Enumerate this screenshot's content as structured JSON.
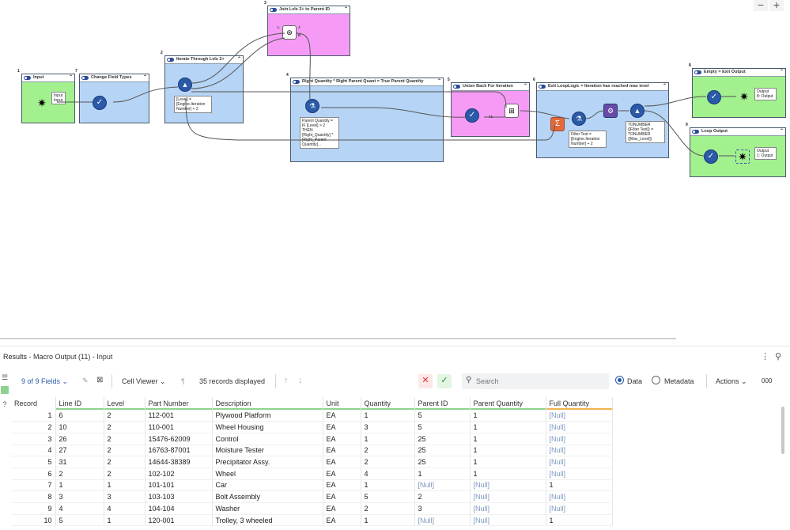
{
  "canvas": {
    "zoom_out": "−",
    "zoom_in": "+",
    "containers": [
      {
        "key": "input",
        "title": "Input",
        "num": "1"
      },
      {
        "key": "change",
        "title": "Change Field Types",
        "num": "7"
      },
      {
        "key": "iterate",
        "title": "Iterate Through Lvls 2+",
        "num": "2"
      },
      {
        "key": "join",
        "title": "Join Lvls 2+ to Parent ID",
        "num": "3"
      },
      {
        "key": "rightqty",
        "title": "Right Quantity * Right Parent Quant = True Parent Quantity",
        "num": "4"
      },
      {
        "key": "union",
        "title": "Union Back For Iteration",
        "num": "5"
      },
      {
        "key": "exitloop",
        "title": "Exit LoopLogic = Iteration has reached max level",
        "num": "6"
      },
      {
        "key": "empty",
        "title": "Empty = Exit Output",
        "num": "8"
      },
      {
        "key": "loopout",
        "title": "Loop Output",
        "num": "9"
      }
    ],
    "annotations": {
      "input_tool": "Input\nInput",
      "iterate_formula": "[Level] =\n[Engine.Iteration\nNumber] + 2",
      "rightqty_formula": "Parent Quantity =\nIF [Level] > 2\nTHEN\n[Right_Quantity] *\n[Right_Parent\nQuantity]...",
      "filter_formula": "Filter Test =\n[Engine.Iteration\nNumber] + 2",
      "tonumber_formula": "TONUMBER\n([Filter Test]) =\nTONUMBER\n([Max_Level])",
      "empty_output": "Output\n8: Output",
      "loop_output": "Output\n1: Output"
    },
    "union_pin": "#1",
    "join_pins": [
      "L",
      "J",
      "R"
    ]
  },
  "results": {
    "title": "Results",
    "subtitle": " - Macro Output (11) - Input",
    "toolbar": {
      "fields_label": "9 of 9 Fields",
      "cell_viewer_label": "Cell Viewer",
      "records_label": "35 records displayed",
      "search_placeholder": "Search",
      "data_label": "Data",
      "metadata_label": "Metadata",
      "actions_label": "Actions",
      "more_label": "000"
    },
    "columns": [
      "Record",
      "Line ID",
      "Level",
      "Part Number",
      "Description",
      "Unit",
      "Quantity",
      "Parent ID",
      "Parent Quantity",
      "Full Quantity"
    ],
    "column_colors": [
      "",
      "#8ed28e",
      "#8ed28e",
      "#8ed28e",
      "#8ed28e",
      "#8ed28e",
      "#8ed28e",
      "#8ed28e",
      "#8ed28e",
      "#f2b44e"
    ],
    "rows": [
      [
        "1",
        "6",
        "2",
        "112-001",
        "Plywood Platform",
        "EA",
        "1",
        "5",
        "1",
        "[Null]"
      ],
      [
        "2",
        "10",
        "2",
        "110-001",
        "Wheel Housing",
        "EA",
        "3",
        "5",
        "1",
        "[Null]"
      ],
      [
        "3",
        "26",
        "2",
        "15476-62009",
        "Control",
        "EA",
        "1",
        "25",
        "1",
        "[Null]"
      ],
      [
        "4",
        "27",
        "2",
        "16763-87001",
        "Moisture Tester",
        "EA",
        "2",
        "25",
        "1",
        "[Null]"
      ],
      [
        "5",
        "31",
        "2",
        "14644-38389",
        "Precipitator Assy.",
        "EA",
        "2",
        "25",
        "1",
        "[Null]"
      ],
      [
        "6",
        "2",
        "2",
        "102-102",
        "Wheel",
        "EA",
        "4",
        "1",
        "1",
        "[Null]"
      ],
      [
        "7",
        "1",
        "1",
        "101-101",
        "Car",
        "EA",
        "1",
        "[Null]",
        "[Null]",
        "1"
      ],
      [
        "8",
        "3",
        "3",
        "103-103",
        "Bolt Assembly",
        "EA",
        "5",
        "2",
        "[Null]",
        "[Null]"
      ],
      [
        "9",
        "4",
        "4",
        "104-104",
        "Washer",
        "EA",
        "2",
        "3",
        "[Null]",
        "[Null]"
      ],
      [
        "10",
        "5",
        "1",
        "120-001",
        "Trolley, 3 wheeled",
        "EA",
        "1",
        "[Null]",
        "[Null]",
        "1"
      ]
    ]
  },
  "colors": {
    "container_blue": "#b6d4f5",
    "container_pink": "#f59bf5",
    "container_green": "#a3f08f",
    "tool_blue": "#2a5aa8",
    "null_text": "#7d97bf",
    "link_blue": "#2a5aa8"
  }
}
